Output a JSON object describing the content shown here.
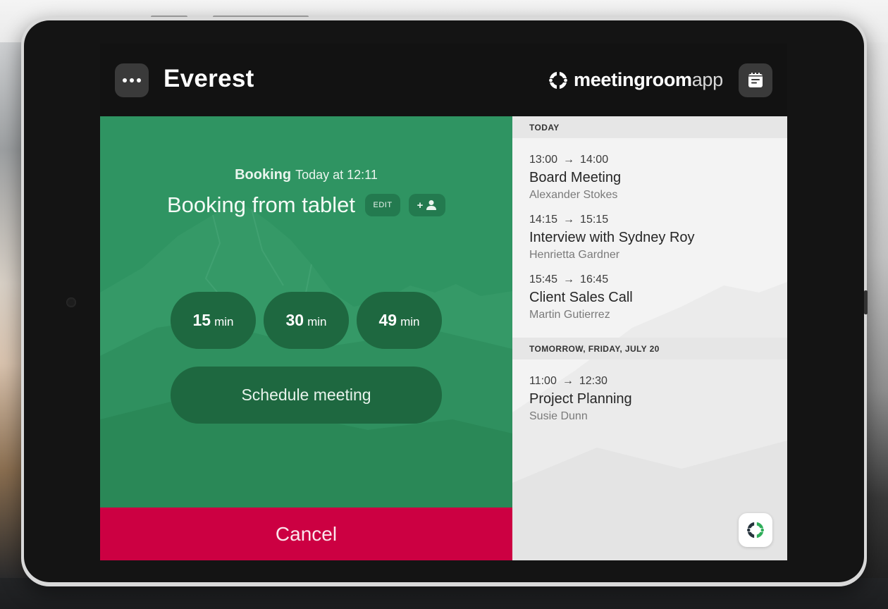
{
  "header": {
    "room_name": "Everest",
    "brand_bold": "meetingroom",
    "brand_light": "app",
    "menu_icon": "more-horizontal-icon",
    "calendar_icon": "calendar-icon"
  },
  "booking": {
    "label": "Booking",
    "when": "Today at 12:11",
    "title": "Booking from tablet",
    "edit_label": "EDIT",
    "add_attendee_plus": "+",
    "add_attendee_icon": "add-person-icon"
  },
  "durations": [
    {
      "value": "15",
      "unit": "min"
    },
    {
      "value": "30",
      "unit": "min"
    },
    {
      "value": "49",
      "unit": "min"
    }
  ],
  "schedule_label": "Schedule meeting",
  "cancel_label": "Cancel",
  "agenda": {
    "sections": [
      {
        "heading": "TODAY",
        "events": [
          {
            "start": "13:00",
            "end": "14:00",
            "title": "Board Meeting",
            "organizer": "Alexander Stokes"
          },
          {
            "start": "14:15",
            "end": "15:15",
            "title": "Interview with Sydney Roy",
            "organizer": "Henrietta Gardner"
          },
          {
            "start": "15:45",
            "end": "16:45",
            "title": "Client Sales Call",
            "organizer": "Martin Gutierrez"
          }
        ]
      },
      {
        "heading": "TOMORROW, FRIDAY, JULY 20",
        "events": [
          {
            "start": "11:00",
            "end": "12:30",
            "title": "Project Planning",
            "organizer": "Susie Dunn"
          }
        ]
      }
    ],
    "arrow": "→"
  },
  "colors": {
    "accent_green": "#2f9462",
    "button_green": "#1e6840",
    "cancel_red": "#cc0042",
    "header_bg": "#121212",
    "logo_green": "#2fae5a",
    "logo_dark": "#25323c"
  }
}
